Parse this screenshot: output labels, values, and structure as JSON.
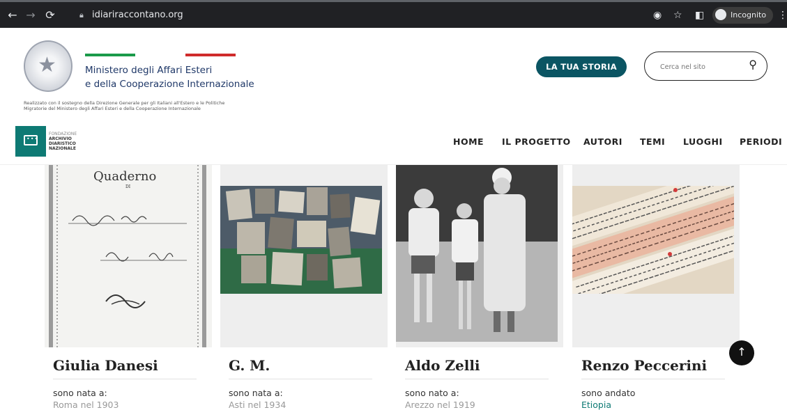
{
  "browser": {
    "url": "idiariraccontano.org",
    "profile_label": "Incognito"
  },
  "header": {
    "ministry_line1": "Ministero degli Affari Esteri",
    "ministry_line2": "e della Cooperazione Internazionale",
    "tagline_line1": "Realizzato con il sostegno della Direzione Generale per gli Italiani all'Estero e le Politiche",
    "tagline_line2": "Migratorie del Ministero degli Affari Esteri e della Cooperazione Internazionale",
    "cta_label": "LA TUA STORIA",
    "search_placeholder": "Cerca nel sito",
    "foundation_line1": "FONDAZIONE",
    "foundation_line2": "ARCHIVIO",
    "foundation_line3": "DIARISTICO",
    "foundation_line4": "NAZIONALE"
  },
  "nav": {
    "items": [
      "HOME",
      "IL PROGETTO",
      "AUTORI",
      "TEMI",
      "LUOGHI",
      "PERIODI"
    ]
  },
  "cards": [
    {
      "name": "Giulia Danesi",
      "line1": "sono nata a:",
      "line2": "Roma nel 1903"
    },
    {
      "name": "G. M.",
      "line1": "sono nata a:",
      "line2": "Asti nel 1934"
    },
    {
      "name": "Aldo Zelli",
      "line1": "sono nato a:",
      "line2": "Arezzo nel 1919"
    },
    {
      "name": "Renzo Peccerini",
      "line1": "sono andato",
      "line2": "Etiopia"
    }
  ],
  "notebook": {
    "label": "Quaderno",
    "di": "DI"
  },
  "colors": {
    "brand_teal": "#0e7a74",
    "cta_bg": "#0b5563",
    "chrome_bg": "#202124"
  }
}
